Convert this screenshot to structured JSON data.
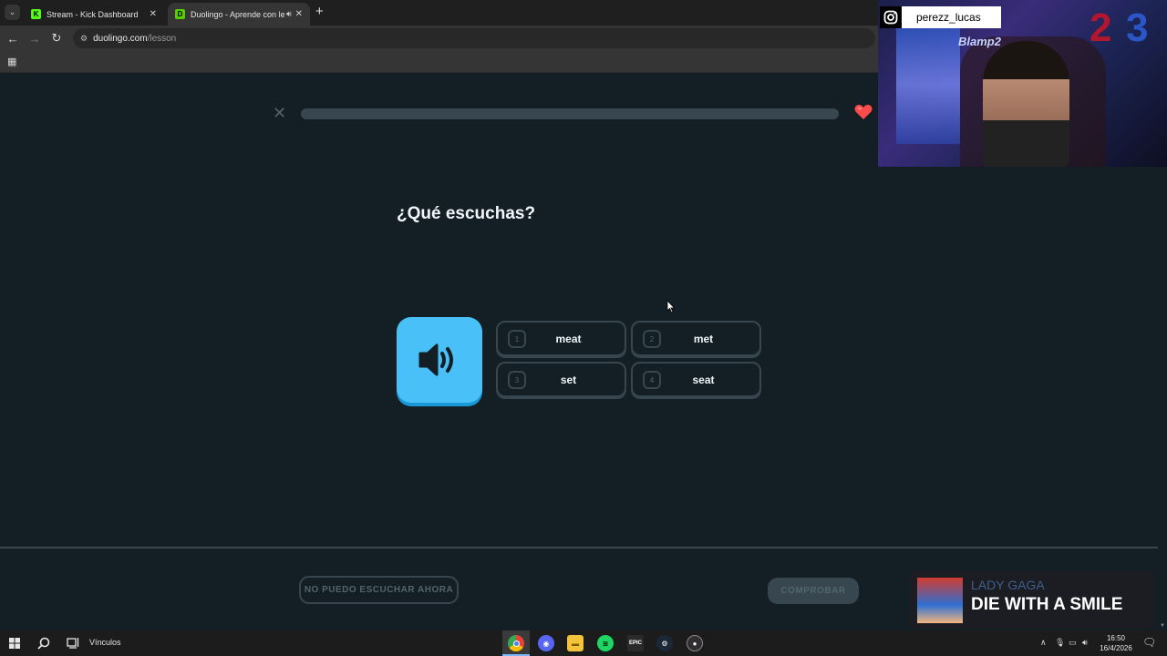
{
  "browser": {
    "tabs": [
      {
        "title": "Stream - Kick Dashboard",
        "favicon": "K",
        "favicon_color": "#53fc18"
      },
      {
        "title": "Duolingo - Aprende con lecciones",
        "favicon": "D",
        "favicon_color": "#58cc02"
      }
    ],
    "url_host": "duolingo.com",
    "url_path": "/lesson"
  },
  "lesson": {
    "progress": 0.0,
    "hearts": "",
    "prompt": "¿Qué escuchas?",
    "options": [
      {
        "num": "1",
        "label": "meat"
      },
      {
        "num": "2",
        "label": "met"
      },
      {
        "num": "3",
        "label": "set"
      },
      {
        "num": "4",
        "label": "seat"
      }
    ],
    "cant_listen_label": "NO PUEDO ESCUCHAR AHORA",
    "check_label": "COMPROBAR",
    "colors": {
      "bg": "#131f24",
      "speaker": "#49c0f8",
      "border": "#37464f",
      "heart": "#ff4b4b"
    }
  },
  "overlay": {
    "instagram_handle": "perezz_lucas",
    "neon_sign": "Blamp2",
    "balloons": [
      "2",
      "3"
    ]
  },
  "now_playing": {
    "artist": "LADY GAGA",
    "title": "DIE WITH A SMILE"
  },
  "taskbar": {
    "links_label": "Vínculos",
    "time": "16:50",
    "date": "16/4/2026",
    "apps": [
      "chrome-icon",
      "discord-icon",
      "file-explorer-icon",
      "spotify-icon",
      "epic-games-icon",
      "steam-icon",
      "obs-icon"
    ],
    "epic_label": "EPIC"
  }
}
